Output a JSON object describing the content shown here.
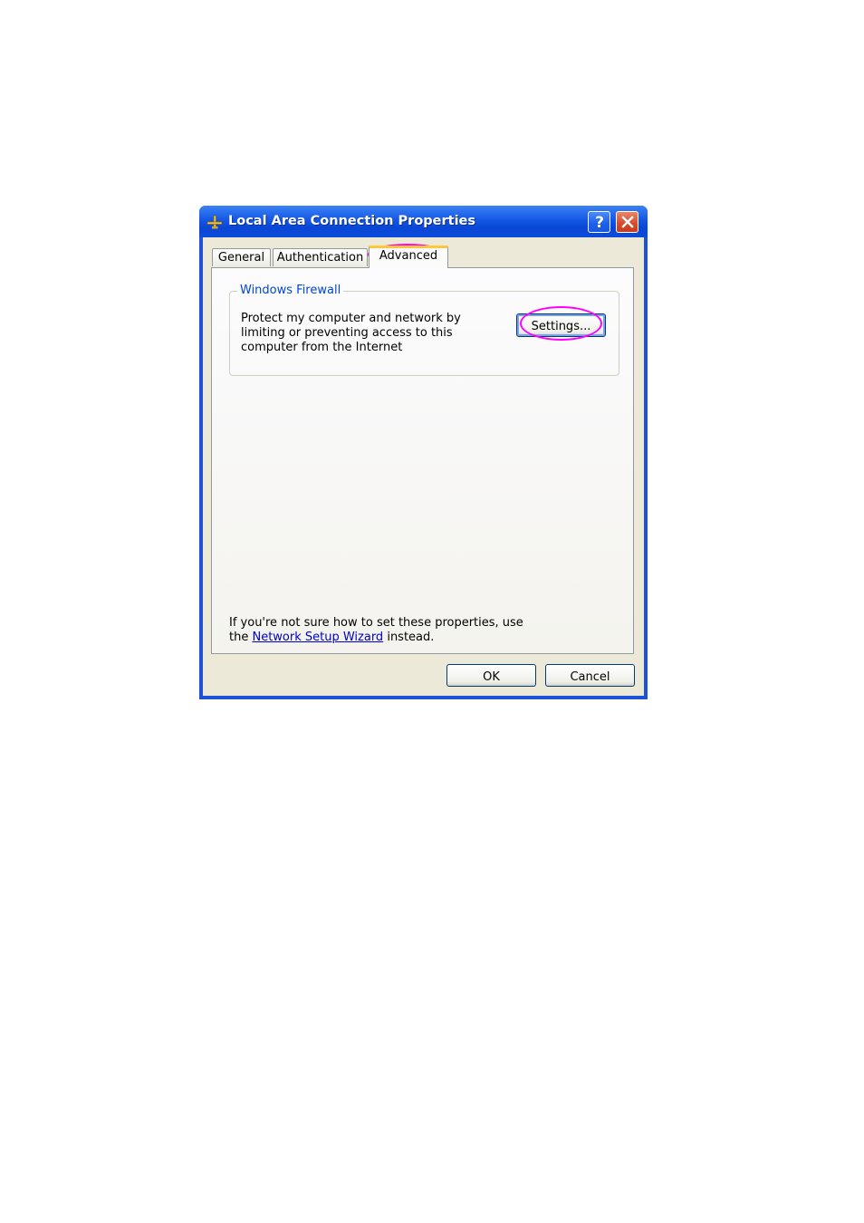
{
  "window": {
    "title": "Local Area Connection Properties",
    "title_icon": "network-connection-icon",
    "help_icon": "help-question-icon",
    "close_icon": "close-x-icon"
  },
  "tabs": [
    {
      "label": "General",
      "selected": false
    },
    {
      "label": "Authentication",
      "selected": false
    },
    {
      "label": "Advanced",
      "selected": true
    }
  ],
  "firewall_group": {
    "title": "Windows Firewall",
    "description": "Protect my computer and network by limiting or preventing access to this computer from the Internet",
    "settings_label": "Settings..."
  },
  "help": {
    "line1": "If you're not sure how to set these properties, use",
    "prefix": "the ",
    "link_text": "Network Setup Wizard",
    "suffix": " instead."
  },
  "buttons": {
    "ok": "OK",
    "cancel": "Cancel"
  },
  "colors": {
    "highlight_annotation": "#ff00ff",
    "titlebar": "#0a46d4",
    "group_title": "#0046d5",
    "link": "#0000cc"
  }
}
